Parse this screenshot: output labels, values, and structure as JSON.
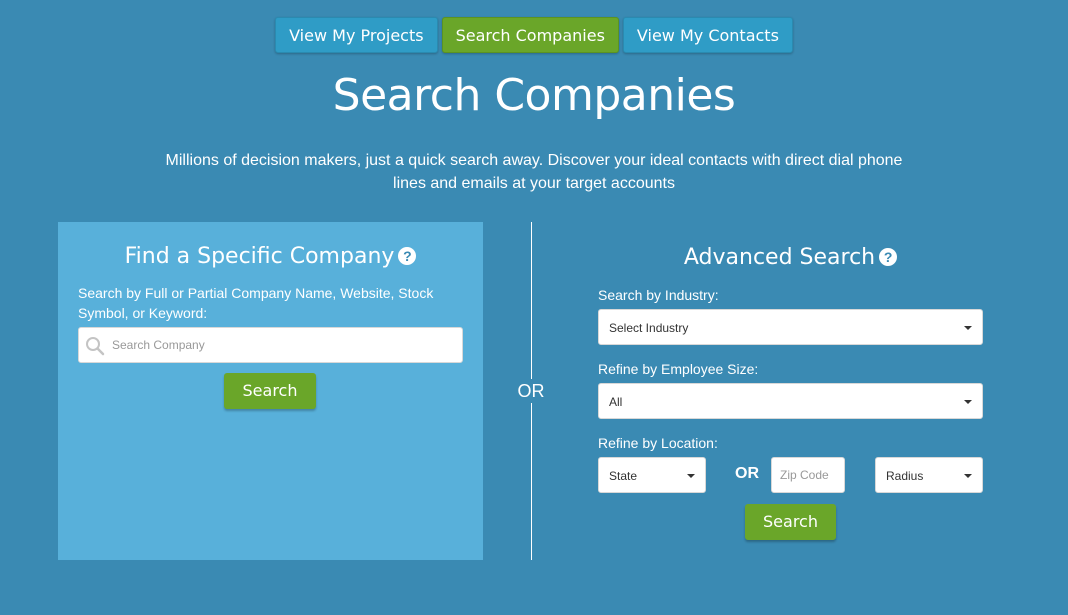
{
  "nav": {
    "view_projects": "View My Projects",
    "search_companies": "Search Companies",
    "view_contacts": "View My Contacts"
  },
  "header": {
    "title": "Search Companies",
    "subtitle": "Millions of decision makers, just a quick search away. Discover your ideal contacts with direct dial phone lines and emails at your target accounts"
  },
  "specific": {
    "title": "Find a Specific Company",
    "help_icon": "?",
    "label": "Search by Full or Partial Company Name, Website, Stock Symbol, or Keyword:",
    "placeholder": "Search Company",
    "button": "Search"
  },
  "or_label": "OR",
  "advanced": {
    "title": "Advanced Search",
    "help_icon": "?",
    "industry_label": "Search by Industry:",
    "industry_value": "Select Industry",
    "employee_label": "Refine by Employee Size:",
    "employee_value": "All",
    "location_label": "Refine by Location:",
    "state_value": "State",
    "or_label": "OR",
    "zip_placeholder": "Zip Code",
    "radius_value": "Radius",
    "button": "Search"
  },
  "colors": {
    "background": "#3a8ab3",
    "panel": "#58b0da",
    "nav_button": "#2f9cc6",
    "active_green": "#6aa629"
  },
  "icons": {
    "search": "search-icon",
    "help": "help-icon",
    "dropdown": "caret-down-icon"
  }
}
